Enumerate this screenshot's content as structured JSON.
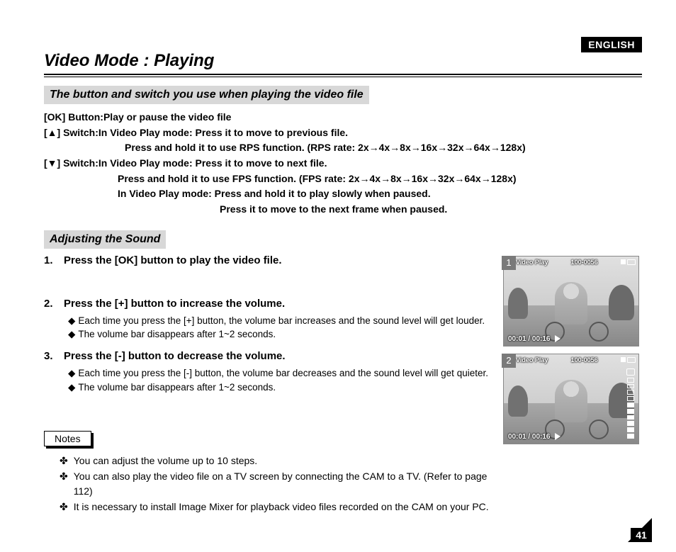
{
  "lang_badge": "ENGLISH",
  "title": "Video Mode : Playing",
  "subheading1": "The button and switch you use when playing the video file",
  "controls": {
    "ok_label": "[OK] Button:",
    "ok_text": " Play or pause the video file",
    "up_label": "[▲] Switch:",
    "up_text": "  In Video Play mode: Press it to move to previous file.",
    "up_hold": "Press and hold it to use RPS function. (RPS rate: 2x→4x→8x→16x→32x→64x→128x)",
    "down_label": "[▼] Switch:",
    "down_text": " In Video Play mode: Press it to move to next file.",
    "down_hold": "Press and hold it to use FPS function. (FPS rate: 2x→4x→8x→16x→32x→64x→128x)",
    "down_pause": "In Video Play mode: Press and hold it to play slowly when paused.",
    "down_frame": "Press it to move to the next frame when paused."
  },
  "subheading2": "Adjusting the Sound",
  "steps": [
    {
      "num": "1.",
      "head": "Press the [OK] button to play the video file.",
      "bullets": []
    },
    {
      "num": "2.",
      "head": "Press the [+] button to increase the volume.",
      "bullets": [
        "Each time you press the [+] button, the volume bar increases and the sound level will get louder.",
        "The volume bar disappears after 1~2 seconds."
      ]
    },
    {
      "num": "3.",
      "head": "Press the [-] button to decrease the volume.",
      "bullets": [
        "Each time you press the [-] button, the volume bar decreases and the sound level will get quieter.",
        "The volume bar disappears after 1~2 seconds."
      ]
    }
  ],
  "thumbs": [
    {
      "num": "1",
      "mode": "Video Play",
      "count": "100-0056",
      "time": "00:01 / 00:16",
      "volume": false
    },
    {
      "num": "2",
      "mode": "Video Play",
      "count": "100-0056",
      "time": "00:01 / 00:16",
      "volume": true
    }
  ],
  "notes_label": "Notes",
  "notes": [
    "You can adjust the volume up to 10 steps.",
    "You can also play the video file on a TV screen by connecting the CAM to a TV. (Refer to page 112)",
    "It is necessary to install Image Mixer for playback video files recorded on the CAM on your PC."
  ],
  "page_number": "41"
}
